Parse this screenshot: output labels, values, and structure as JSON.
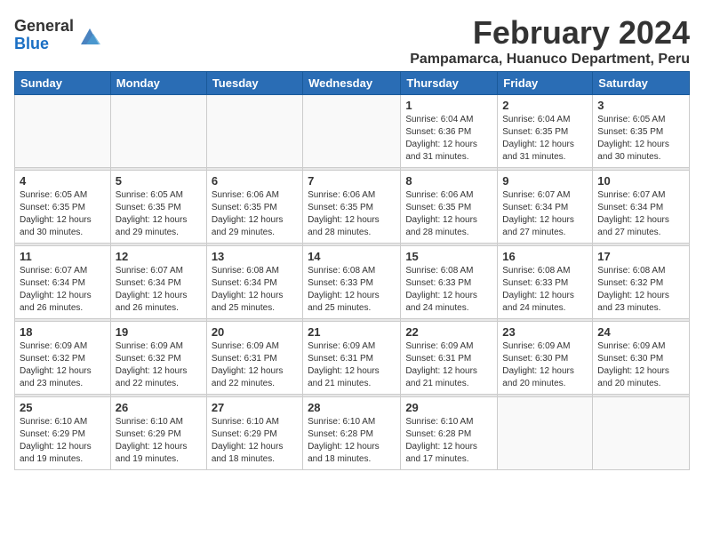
{
  "logo": {
    "general": "General",
    "blue": "Blue"
  },
  "title": {
    "month": "February 2024",
    "location": "Pampamarca, Huanuco Department, Peru"
  },
  "headers": [
    "Sunday",
    "Monday",
    "Tuesday",
    "Wednesday",
    "Thursday",
    "Friday",
    "Saturday"
  ],
  "weeks": [
    [
      {
        "day": "",
        "info": ""
      },
      {
        "day": "",
        "info": ""
      },
      {
        "day": "",
        "info": ""
      },
      {
        "day": "",
        "info": ""
      },
      {
        "day": "1",
        "info": "Sunrise: 6:04 AM\nSunset: 6:36 PM\nDaylight: 12 hours and 31 minutes."
      },
      {
        "day": "2",
        "info": "Sunrise: 6:04 AM\nSunset: 6:35 PM\nDaylight: 12 hours and 31 minutes."
      },
      {
        "day": "3",
        "info": "Sunrise: 6:05 AM\nSunset: 6:35 PM\nDaylight: 12 hours and 30 minutes."
      }
    ],
    [
      {
        "day": "4",
        "info": "Sunrise: 6:05 AM\nSunset: 6:35 PM\nDaylight: 12 hours and 30 minutes."
      },
      {
        "day": "5",
        "info": "Sunrise: 6:05 AM\nSunset: 6:35 PM\nDaylight: 12 hours and 29 minutes."
      },
      {
        "day": "6",
        "info": "Sunrise: 6:06 AM\nSunset: 6:35 PM\nDaylight: 12 hours and 29 minutes."
      },
      {
        "day": "7",
        "info": "Sunrise: 6:06 AM\nSunset: 6:35 PM\nDaylight: 12 hours and 28 minutes."
      },
      {
        "day": "8",
        "info": "Sunrise: 6:06 AM\nSunset: 6:35 PM\nDaylight: 12 hours and 28 minutes."
      },
      {
        "day": "9",
        "info": "Sunrise: 6:07 AM\nSunset: 6:34 PM\nDaylight: 12 hours and 27 minutes."
      },
      {
        "day": "10",
        "info": "Sunrise: 6:07 AM\nSunset: 6:34 PM\nDaylight: 12 hours and 27 minutes."
      }
    ],
    [
      {
        "day": "11",
        "info": "Sunrise: 6:07 AM\nSunset: 6:34 PM\nDaylight: 12 hours and 26 minutes."
      },
      {
        "day": "12",
        "info": "Sunrise: 6:07 AM\nSunset: 6:34 PM\nDaylight: 12 hours and 26 minutes."
      },
      {
        "day": "13",
        "info": "Sunrise: 6:08 AM\nSunset: 6:34 PM\nDaylight: 12 hours and 25 minutes."
      },
      {
        "day": "14",
        "info": "Sunrise: 6:08 AM\nSunset: 6:33 PM\nDaylight: 12 hours and 25 minutes."
      },
      {
        "day": "15",
        "info": "Sunrise: 6:08 AM\nSunset: 6:33 PM\nDaylight: 12 hours and 24 minutes."
      },
      {
        "day": "16",
        "info": "Sunrise: 6:08 AM\nSunset: 6:33 PM\nDaylight: 12 hours and 24 minutes."
      },
      {
        "day": "17",
        "info": "Sunrise: 6:08 AM\nSunset: 6:32 PM\nDaylight: 12 hours and 23 minutes."
      }
    ],
    [
      {
        "day": "18",
        "info": "Sunrise: 6:09 AM\nSunset: 6:32 PM\nDaylight: 12 hours and 23 minutes."
      },
      {
        "day": "19",
        "info": "Sunrise: 6:09 AM\nSunset: 6:32 PM\nDaylight: 12 hours and 22 minutes."
      },
      {
        "day": "20",
        "info": "Sunrise: 6:09 AM\nSunset: 6:31 PM\nDaylight: 12 hours and 22 minutes."
      },
      {
        "day": "21",
        "info": "Sunrise: 6:09 AM\nSunset: 6:31 PM\nDaylight: 12 hours and 21 minutes."
      },
      {
        "day": "22",
        "info": "Sunrise: 6:09 AM\nSunset: 6:31 PM\nDaylight: 12 hours and 21 minutes."
      },
      {
        "day": "23",
        "info": "Sunrise: 6:09 AM\nSunset: 6:30 PM\nDaylight: 12 hours and 20 minutes."
      },
      {
        "day": "24",
        "info": "Sunrise: 6:09 AM\nSunset: 6:30 PM\nDaylight: 12 hours and 20 minutes."
      }
    ],
    [
      {
        "day": "25",
        "info": "Sunrise: 6:10 AM\nSunset: 6:29 PM\nDaylight: 12 hours and 19 minutes."
      },
      {
        "day": "26",
        "info": "Sunrise: 6:10 AM\nSunset: 6:29 PM\nDaylight: 12 hours and 19 minutes."
      },
      {
        "day": "27",
        "info": "Sunrise: 6:10 AM\nSunset: 6:29 PM\nDaylight: 12 hours and 18 minutes."
      },
      {
        "day": "28",
        "info": "Sunrise: 6:10 AM\nSunset: 6:28 PM\nDaylight: 12 hours and 18 minutes."
      },
      {
        "day": "29",
        "info": "Sunrise: 6:10 AM\nSunset: 6:28 PM\nDaylight: 12 hours and 17 minutes."
      },
      {
        "day": "",
        "info": ""
      },
      {
        "day": "",
        "info": ""
      }
    ]
  ]
}
